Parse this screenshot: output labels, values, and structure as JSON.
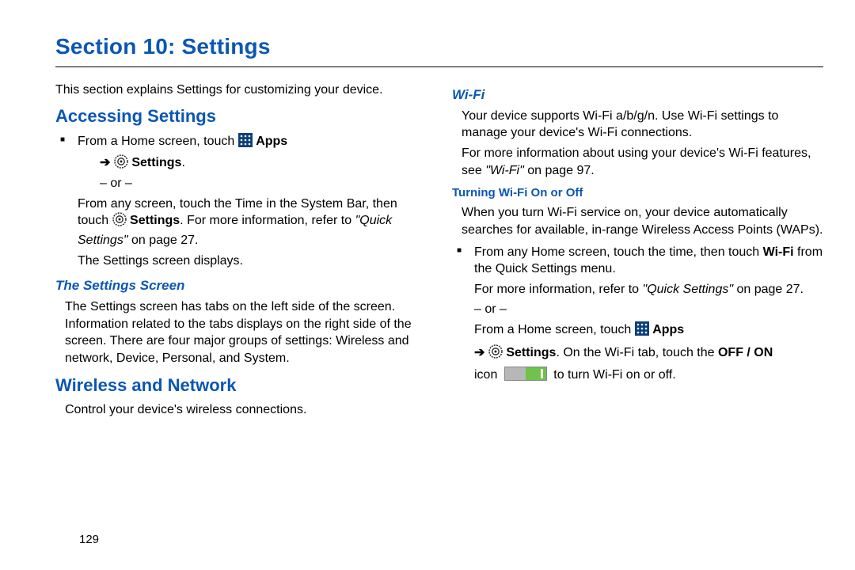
{
  "page_number": "129",
  "title": "Section 10: Settings",
  "left": {
    "intro": "This section explains Settings for customizing your device.",
    "h_access": "Accessing Settings",
    "b1_pre": "From a Home screen, touch ",
    "b1_apps": "Apps",
    "b1_arrow": "➔",
    "b1_settings": "Settings",
    "b1_post": ".",
    "or": "– or –",
    "p2a": "From any screen, touch the Time in the System Bar, then touch ",
    "p2_settings": "Settings",
    "p2b": ". For more information, refer to ",
    "p2_ref": "\"Quick Settings\"",
    "p2c": " on page 27.",
    "p3": "The Settings screen displays.",
    "h_screen": "The Settings Screen",
    "p_screen": "The Settings screen has tabs on the left side of the screen. Information related to the tabs displays on the right side of the screen. There are four major groups of settings: Wireless and network, Device, Personal, and System.",
    "h_wireless": "Wireless and Network",
    "p_wireless": "Control your device's wireless connections."
  },
  "right": {
    "h_wifi": "Wi-Fi",
    "p_wifi1": "Your device supports Wi-Fi a/b/g/n. Use Wi-Fi settings to manage your device's Wi-Fi connections.",
    "p_wifi2a": "For more information about using your device's Wi-Fi features, see ",
    "p_wifi2_ref": "\"Wi-Fi\"",
    "p_wifi2b": " on page 97.",
    "h_turn": "Turning Wi-Fi On or Off",
    "p_turn": "When you turn Wi-Fi service on, your device automatically searches for available, in-range Wireless Access Points (WAPs).",
    "b2a": "From any Home screen, touch the time, then touch ",
    "b2_wifi": "Wi-Fi",
    "b2b": " from the Quick Settings menu.",
    "b2c_pre": "For more information, refer to ",
    "b2c_ref": "\"Quick Settings\"",
    "b2c_post": " on page 27.",
    "or": "– or –",
    "b3_pre": "From a Home screen, touch ",
    "b3_apps": "Apps",
    "b3_arrow": "➔",
    "b3_settings": "Settings",
    "b3_mid": ". On the Wi-Fi tab, touch the ",
    "b3_offon": "OFF / ON",
    "b3_post1": "icon ",
    "b3_post2": " to turn Wi-Fi on or off."
  }
}
